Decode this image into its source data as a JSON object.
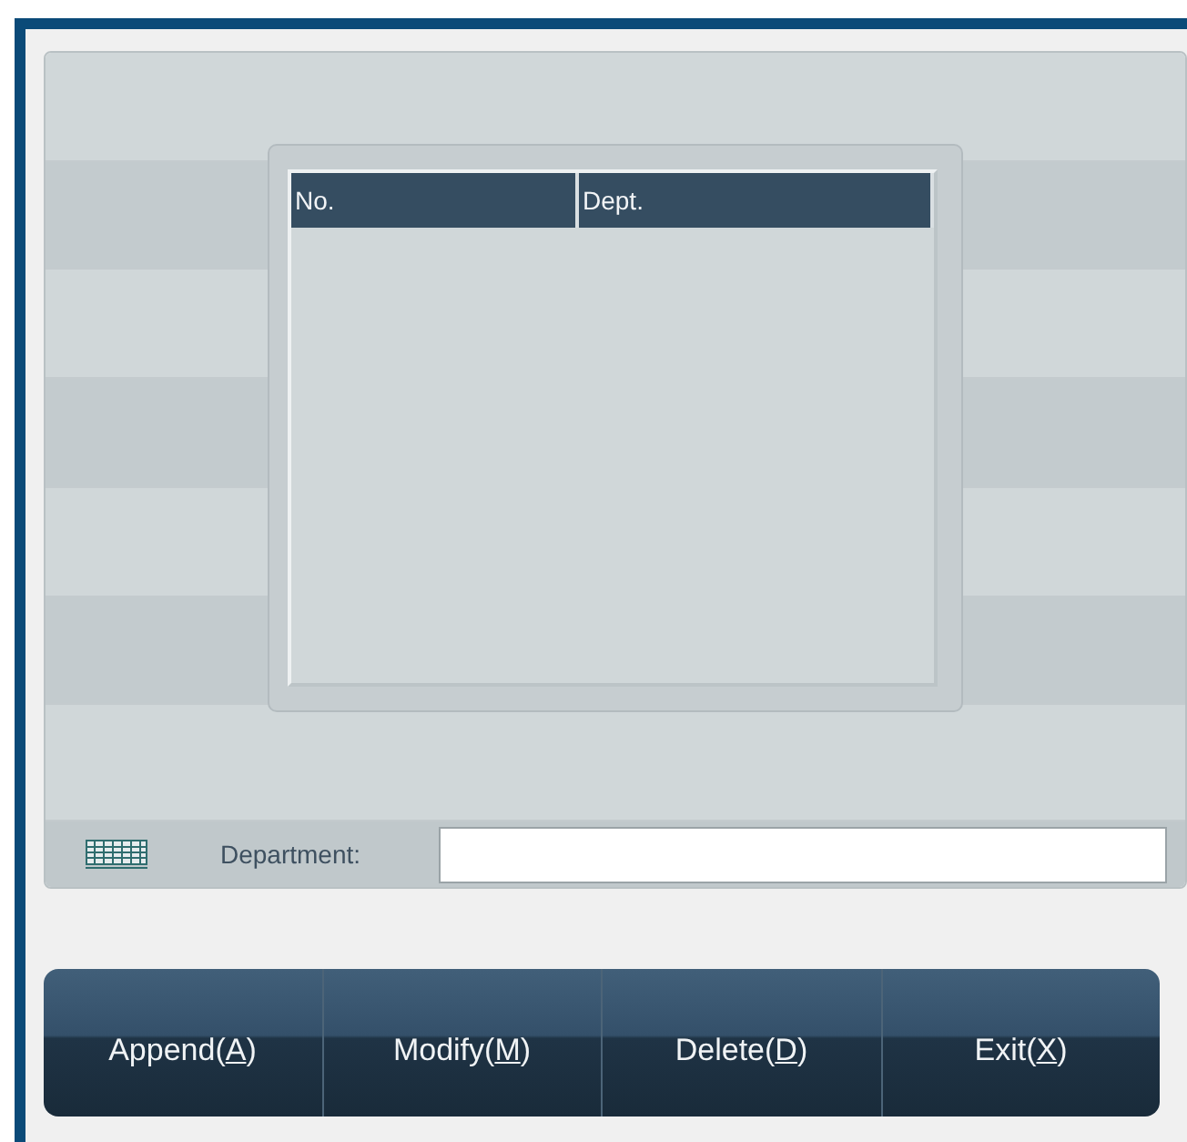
{
  "table": {
    "columns": [
      "No.",
      "Dept."
    ]
  },
  "department_field": {
    "label": "Department:"
  },
  "buttons": [
    {
      "before": "Append(",
      "access_key": "A",
      "after": ")"
    },
    {
      "before": "Modify(",
      "access_key": "M",
      "after": ")"
    },
    {
      "before": "Delete(",
      "access_key": "D",
      "after": ")"
    },
    {
      "before": "Exit(",
      "access_key": "X",
      "after": ")"
    }
  ]
}
